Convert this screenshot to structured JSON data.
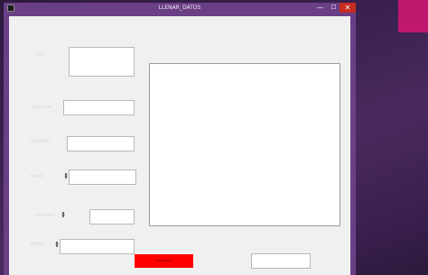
{
  "window": {
    "title": "LLENAR_DATOS",
    "controls": {
      "minimize": "—",
      "maximize": "☐",
      "close": "✕"
    }
  },
  "form": {
    "field1": {
      "label": "Foto:",
      "value": ""
    },
    "field2": {
      "label": "Nombre:",
      "value": ""
    },
    "field3": {
      "label": "Apellido:",
      "value": ""
    },
    "field4": {
      "label": "Edad:",
      "value": ""
    },
    "field5": {
      "label": "Cantidad:",
      "value": ""
    },
    "field6": {
      "label": "Fecha:",
      "value": ""
    }
  },
  "buttons": {
    "primary": "REGISTRAR",
    "secondary": ""
  },
  "colors": {
    "titlebar": "#6a3f86",
    "close_button": "#c72b20",
    "primary_button": "#ff0000",
    "desktop_tile": "#c0186f"
  }
}
